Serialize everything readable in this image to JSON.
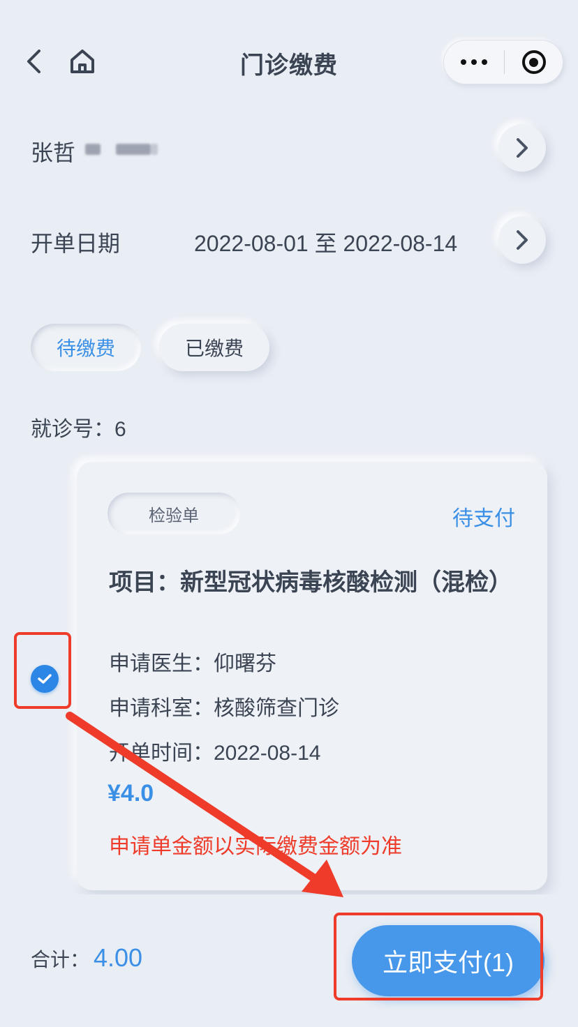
{
  "header": {
    "title": "门诊缴费",
    "back_icon": "chevron-left-icon",
    "home_icon": "home-icon",
    "more_icon": "more-dots-icon",
    "close_icon": "target-icon"
  },
  "patient": {
    "name": "张哲"
  },
  "date_filter": {
    "label": "开单日期",
    "range": "2022-08-01 至 2022-08-14"
  },
  "tabs": [
    {
      "label": "待缴费",
      "active": true
    },
    {
      "label": "已缴费",
      "active": false
    }
  ],
  "visit": {
    "label": "就诊号：6"
  },
  "order": {
    "badge": "检验单",
    "status": "待支付",
    "project_key": "项目：",
    "project_value": "新型冠状病毒核酸检测（混检）",
    "doctor": "申请医生：仰曙芬",
    "department": "申请科室：核酸筛查门诊",
    "time": "开单时间：2022-08-14",
    "price": "¥4.0",
    "notice": "申请单金额以实际缴费金额为准",
    "selected": true
  },
  "footer": {
    "total_label": "合计：",
    "total_value": "4.00",
    "pay_label": "立即支付(1)"
  },
  "colors": {
    "accent": "#3a8fe6",
    "alert": "#ee3b2a",
    "background": "#e9edf4"
  }
}
